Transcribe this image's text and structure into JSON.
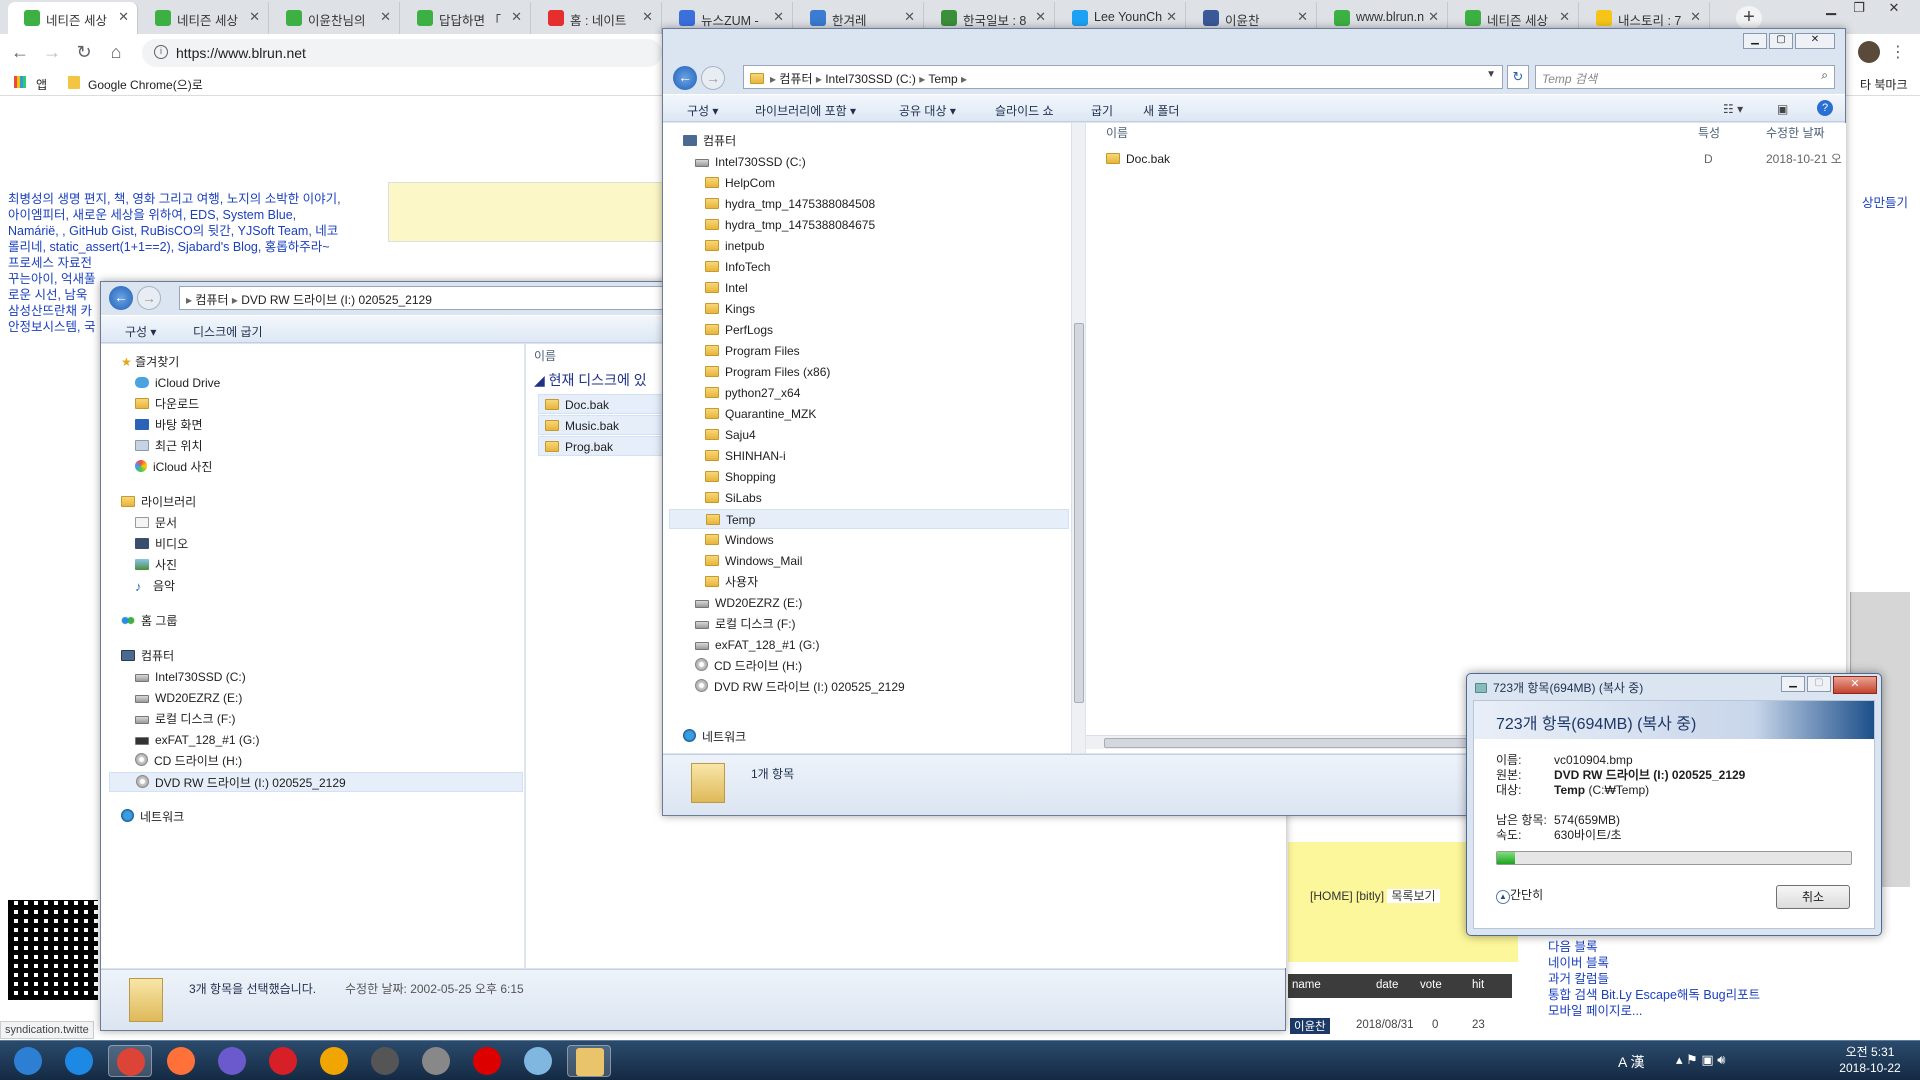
{
  "chrome": {
    "tabs": [
      {
        "label": "네티즌 세상",
        "fav": "naver-leaf-icon",
        "color": "#3cb043"
      },
      {
        "label": "네티즌 세상",
        "fav": "naver-leaf-icon",
        "color": "#3cb043"
      },
      {
        "label": "이윤찬님의",
        "fav": "naver-leaf-icon",
        "color": "#3cb043"
      },
      {
        "label": "답답하면 「",
        "fav": "naver-leaf-icon",
        "color": "#3cb043"
      },
      {
        "label": "홈 : 네이트",
        "fav": "nate-icon",
        "color": "#e52e2e"
      },
      {
        "label": "뉴스ZUM -",
        "fav": "zum-icon",
        "color": "#3b6fdc"
      },
      {
        "label": "한겨레",
        "fav": "hani-icon",
        "color": "#3b7bd0"
      },
      {
        "label": "한국일보 : 8",
        "fav": "user-icon",
        "color": "#3a8f3a"
      },
      {
        "label": "Lee YounCh",
        "fav": "twitter-icon",
        "color": "#1da1f2"
      },
      {
        "label": "이윤찬",
        "fav": "facebook-icon",
        "color": "#3b5998"
      },
      {
        "label": "www.blrun.n",
        "fav": "naver-leaf-icon",
        "color": "#3cb043"
      },
      {
        "label": "네티즌 세상",
        "fav": "naver-leaf-icon",
        "color": "#3cb043"
      },
      {
        "label": "내스토리 : 7",
        "fav": "kakao-icon",
        "color": "#f5c518"
      }
    ],
    "url": "https://www.blrun.net",
    "bookmarks": {
      "apps": "앱",
      "item1": "Google Chrome(으)로",
      "other": "타 북마크"
    }
  },
  "page": {
    "blog_text": [
      "최병성의 생명 편지, 책, 영화 그리고 여행, 노지의 소박한 이야기,",
      "아이엠피터, 새로운 세상을 위하여, EDS, System Blue,",
      "Namárië, , GitHub Gist, RuBisCO의 뒷간, YJSoft Team, 네코",
      "롤리네, static_assert(1+1==2), Sjabard's Blog, 홍롭하주라~",
      "프로세스 자료전",
      "꾸는아이, 억새풀",
      "로운 시선, 남욱",
      "삼성산뜨란채 카",
      "안정보시스템, 국"
    ],
    "right_link": "상만들기",
    "nav": {
      "home": "[HOME]",
      "bitly": "[bitly]",
      "list": "목록보기"
    },
    "table_headers": [
      "name",
      "date",
      "vote",
      "hit"
    ],
    "table_row": {
      "name": "이윤찬",
      "date": "2018/08/31",
      "vote": "0",
      "hit": "23"
    },
    "links": [
      "다음 블록",
      "네이버 블록",
      "과거 칼럼들",
      "통합 검색 Bit.Ly Escape해독 Bug리포트",
      "모바일 페이지로..."
    ],
    "status_url": "syndication.twitte"
  },
  "explorer_c": {
    "path": [
      "컴퓨터",
      "Intel730SSD (C:)",
      "Temp"
    ],
    "search_placeholder": "Temp 검색",
    "commands": [
      "구성",
      "라이브러리에 포함",
      "공유 대상",
      "슬라이드 쇼",
      "굽기",
      "새 폴더"
    ],
    "tree": [
      {
        "label": "컴퓨터",
        "type": "computer",
        "level": 0
      },
      {
        "label": "Intel730SSD (C:)",
        "type": "drive-sys",
        "level": 1
      },
      {
        "label": "HelpCom",
        "type": "folder",
        "level": 2
      },
      {
        "label": "hydra_tmp_1475388084508",
        "type": "folder",
        "level": 2
      },
      {
        "label": "hydra_tmp_1475388084675",
        "type": "folder",
        "level": 2
      },
      {
        "label": "inetpub",
        "type": "folder",
        "level": 2
      },
      {
        "label": "InfoTech",
        "type": "folder",
        "level": 2
      },
      {
        "label": "Intel",
        "type": "folder",
        "level": 2
      },
      {
        "label": "Kings",
        "type": "folder",
        "level": 2
      },
      {
        "label": "PerfLogs",
        "type": "folder",
        "level": 2
      },
      {
        "label": "Program Files",
        "type": "folder",
        "level": 2
      },
      {
        "label": "Program Files (x86)",
        "type": "folder",
        "level": 2
      },
      {
        "label": "python27_x64",
        "type": "folder",
        "level": 2
      },
      {
        "label": "Quarantine_MZK",
        "type": "folder",
        "level": 2
      },
      {
        "label": "Saju4",
        "type": "folder",
        "level": 2
      },
      {
        "label": "SHINHAN-i",
        "type": "folder",
        "level": 2
      },
      {
        "label": "Shopping",
        "type": "folder",
        "level": 2
      },
      {
        "label": "SiLabs",
        "type": "folder",
        "level": 2
      },
      {
        "label": "Temp",
        "type": "folder",
        "level": 2,
        "selected": true
      },
      {
        "label": "Windows",
        "type": "folder",
        "level": 2
      },
      {
        "label": "Windows_Mail",
        "type": "folder",
        "level": 2
      },
      {
        "label": "사용자",
        "type": "folder",
        "level": 2
      },
      {
        "label": "WD20EZRZ (E:)",
        "type": "drive",
        "level": 1
      },
      {
        "label": "로컬 디스크 (F:)",
        "type": "drive",
        "level": 1
      },
      {
        "label": "exFAT_128_#1 (G:)",
        "type": "drive",
        "level": 1
      },
      {
        "label": "CD 드라이브 (H:)",
        "type": "cd",
        "level": 1
      },
      {
        "label": "DVD RW 드라이브 (I:) 020525_2129",
        "type": "cd",
        "level": 1
      }
    ],
    "network": "네트워크",
    "columns": {
      "name": "이름",
      "attr": "특성",
      "modified": "수정한 날짜"
    },
    "files": [
      {
        "name": "Doc.bak",
        "attr": "D",
        "modified": "2018-10-21 오"
      }
    ],
    "status": "1개 항목"
  },
  "explorer_dvd": {
    "path": [
      "컴퓨터",
      "DVD RW 드라이브 (I:) 020525_2129"
    ],
    "commands": [
      "구성",
      "디스크에 굽기"
    ],
    "favorites_title": "즐겨찾기",
    "favorites": [
      "iCloud Drive",
      "다운로드",
      "바탕 화면",
      "최근 위치",
      "iCloud 사진"
    ],
    "libraries_title": "라이브러리",
    "libraries": [
      "문서",
      "비디오",
      "사진",
      "음악"
    ],
    "homegroup": "홈 그룹",
    "computer_title": "컴퓨터",
    "drives": [
      "Intel730SSD (C:)",
      "WD20EZRZ (E:)",
      "로컬 디스크 (F:)",
      "exFAT_128_#1 (G:)",
      "CD 드라이브 (H:)",
      "DVD RW 드라이브 (I:) 020525_2129"
    ],
    "network": "네트워크",
    "column_name": "이름",
    "group_header": "현재 디스크에 있",
    "files": [
      "Doc.bak",
      "Music.bak",
      "Prog.bak"
    ],
    "status": "3개 항목을 선택했습니다.",
    "status_date": "수정한 날짜: 2002-05-25 오후 6:15"
  },
  "copy_dialog": {
    "title": "723개 항목(694MB) (복사 중)",
    "heading": "723개 항목(694MB) (복사 중)",
    "name_label": "이름:",
    "name": "vc010904.bmp",
    "from_label": "원본:",
    "from": "DVD RW 드라이브 (I:) 020525_2129",
    "to_label": "대상:",
    "to": "Temp",
    "to_path": "(C:₩Temp)",
    "remaining_label": "남은 항목:",
    "remaining": "574(659MB)",
    "speed_label": "속도:",
    "speed": "630바이트/초",
    "progress": 0.05,
    "less_details": "간단히",
    "cancel": "취소"
  },
  "taskbar": {
    "time": "오전 5:31",
    "date": "2018-10-22",
    "ime": "A 漢",
    "apps": [
      "start-orb-icon",
      "ie-icon",
      "chrome-icon",
      "firefox-icon",
      "stack-icon",
      "opera-icon",
      "sublime-icon",
      "book-icon",
      "ball-icon",
      "record-icon",
      "network-icon",
      "explorer-icon"
    ]
  }
}
